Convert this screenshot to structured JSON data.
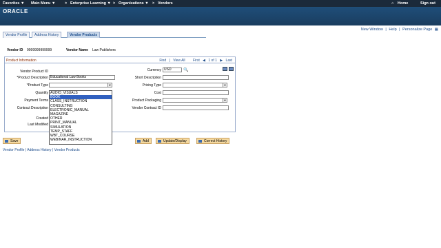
{
  "topnav": {
    "favorites": "Favorites ▼",
    "main_menu": "Main Menu ▼",
    "sep1": ">",
    "enterprise": "Enterprise Learning ▼",
    "sep2": ">",
    "organizations": "Organizations ▼",
    "sep3": ">",
    "vendors": "Vendors",
    "home": "Home",
    "signout": "Sign out"
  },
  "logo": "ORACLE",
  "top_links": [
    "New Window",
    "Help",
    "Personalize Page"
  ],
  "tabs": [
    "Vendor Profile",
    "Address History",
    "Vendor Products"
  ],
  "header": {
    "vendor_id_label": "Vendor ID",
    "vendor_id": "9999999999999",
    "vendor_name_label": "Vendor Name",
    "vendor_name": "Law Publishers"
  },
  "panel": {
    "title": "Product Information",
    "find": "Find",
    "view_all": "View All",
    "first": "First",
    "count": "1 of 1",
    "last": "Last"
  },
  "fields": {
    "vendor_product_id": "Vendor Product ID",
    "product_description": "*Product Description",
    "product_description_value": "Educational Law Books",
    "product_type": "*Product Type",
    "quantity": "Quantity",
    "payment_terms": "Payment Terms",
    "contract_description": "Contract Description",
    "created": "Created",
    "last_modified": "Last Modified",
    "currency": "Currency",
    "currency_value": "USD",
    "short_description": "Short Description",
    "pricing_type": "Pricing Type",
    "cost": "Cost",
    "product_packaging": "Product Packaging",
    "vendor_contract_id": "Vendor Contract ID"
  },
  "dropdown_options": [
    "AUDIO_VISUALS",
    "BOOK",
    "CLASS_INSTRUCTION",
    "CONSULTING",
    "ELECTRONIC_MANUAL",
    "MAGAZINE",
    "OTHER",
    "PRINT_MANUAL",
    "SIMULATION",
    "TEMP_STAFF",
    "WBT_COURSE",
    "WEBINAR_INSTRUCTION"
  ],
  "dropdown_selected_index": 1,
  "buttons": {
    "save": "Save",
    "add": "Add",
    "update": "Update/Display",
    "correct": "Correct History"
  },
  "bottom_links": [
    "Vendor Profile",
    "Address History",
    "Vendor Products"
  ],
  "link_sep": "|"
}
